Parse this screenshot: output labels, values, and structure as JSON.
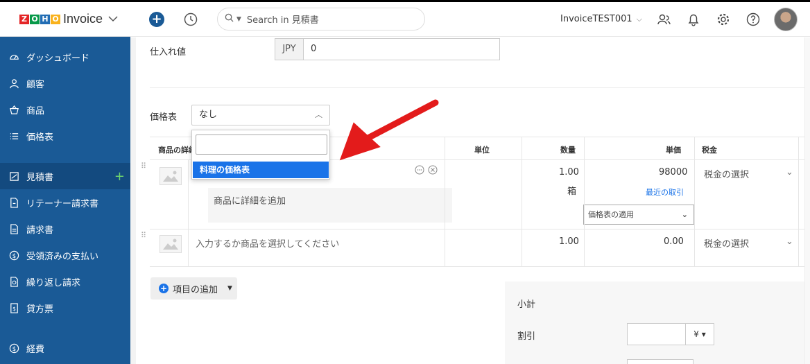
{
  "app": {
    "brand": [
      "Z",
      "O",
      "H",
      "O"
    ],
    "name": "Invoice"
  },
  "header": {
    "search_placeholder": "Search in 見積書",
    "org_name": "InvoiceTEST001"
  },
  "sidebar": {
    "items": [
      {
        "label": "ダッシュボード",
        "icon": "dashboard-icon"
      },
      {
        "label": "顧客",
        "icon": "person-icon"
      },
      {
        "label": "商品",
        "icon": "basket-icon"
      },
      {
        "label": "価格表",
        "icon": "list-icon"
      },
      {
        "label": "見積書",
        "icon": "estimate-icon",
        "active": true
      },
      {
        "label": "リテーナー請求書",
        "icon": "retainer-icon"
      },
      {
        "label": "請求書",
        "icon": "document-icon"
      },
      {
        "label": "受領済みの支払い",
        "icon": "payment-icon"
      },
      {
        "label": "繰り返し請求",
        "icon": "recurring-icon"
      },
      {
        "label": "貸方票",
        "icon": "credit-note-icon"
      },
      {
        "label": "経費",
        "icon": "expense-icon"
      }
    ]
  },
  "form": {
    "purchase_price_label": "仕入れ値",
    "currency": "JPY",
    "purchase_price_value": "0",
    "price_list_label": "価格表",
    "price_list_value": "なし",
    "dropdown_option": "料理の価格表"
  },
  "table": {
    "headers": {
      "item": "商品の詳細",
      "unit": "単位",
      "qty": "数量",
      "rate": "単価",
      "tax": "税金"
    },
    "row1": {
      "detail_placeholder": "商品に詳細を追加",
      "qty": "1.00",
      "unit_label": "箱",
      "rate": "98000",
      "recent_link": "最近の取引",
      "tax": "税金の選択",
      "pricelist_apply": "価格表の適用"
    },
    "row2": {
      "item_placeholder": "入力するか商品を選択してください",
      "qty": "1.00",
      "rate": "0.00",
      "tax": "税金の選択"
    }
  },
  "actions": {
    "add_item": "項目の追加"
  },
  "totals": {
    "subtotal_label": "小計",
    "discount_label": "割引",
    "discount_currency": "¥"
  },
  "colors": {
    "sidebar": "#1a5a96",
    "accent": "#1a73e8",
    "arrow": "#e31b1b"
  }
}
